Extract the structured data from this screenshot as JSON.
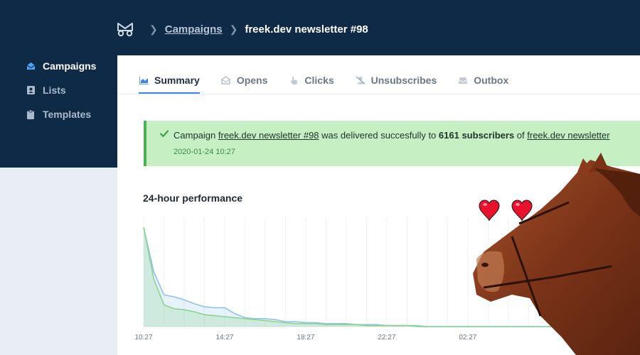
{
  "breadcrumb": {
    "parent": "Campaigns",
    "current": "freek.dev newsletter #98"
  },
  "sidebar": {
    "items": [
      {
        "label": "Campaigns",
        "icon": "envelope-open-icon",
        "active": true
      },
      {
        "label": "Lists",
        "icon": "address-book-icon",
        "active": false
      },
      {
        "label": "Templates",
        "icon": "clipboard-icon",
        "active": false
      }
    ]
  },
  "tabs": [
    {
      "label": "Summary",
      "icon": "chart-area-icon",
      "active": true
    },
    {
      "label": "Opens",
      "icon": "envelope-open-icon",
      "active": false
    },
    {
      "label": "Clicks",
      "icon": "pointer-hand-icon",
      "active": false
    },
    {
      "label": "Unsubscribes",
      "icon": "user-slash-icon",
      "active": false
    },
    {
      "label": "Outbox",
      "icon": "inbox-icon",
      "active": false
    }
  ],
  "alert": {
    "prefix": "Campaign",
    "campaign_link": "freek.dev newsletter #98",
    "middle": "was delivered succesfully to",
    "count": "6161 subscribers",
    "of": "of",
    "list_link": "freek.dev newsletter",
    "date": "2020-01-24 10:27"
  },
  "performance": {
    "title": "24-hour performance"
  },
  "colors": {
    "navy": "#0f2a47",
    "accent": "#3b82f6",
    "success_bg": "#c6efc4",
    "success_border": "#4caf50",
    "opens_line": "#90c2ee",
    "clicks_line": "#8fd48f"
  },
  "chart_data": {
    "type": "area",
    "x_tick_labels": [
      "10:27",
      "14:27",
      "18:27",
      "22:27",
      "02:27"
    ],
    "series": [
      {
        "values": [
          100,
          55,
          32,
          30,
          27,
          23,
          20,
          19,
          19,
          13,
          9,
          8,
          8,
          7,
          5,
          5,
          4,
          4,
          3,
          3,
          3,
          2,
          2,
          2,
          1,
          1,
          1,
          0,
          0,
          0,
          0,
          0,
          0,
          0,
          0,
          0,
          0,
          0,
          0,
          0,
          0,
          0,
          0,
          0,
          0,
          0,
          0,
          0,
          0,
          0
        ]
      },
      {
        "values": [
          100,
          48,
          22,
          18,
          17,
          15,
          12,
          11,
          10,
          9,
          8,
          7,
          6,
          5,
          4,
          3,
          3,
          3,
          2,
          2,
          2,
          2,
          1,
          1,
          1,
          1,
          1,
          1,
          0,
          0,
          0,
          0,
          0,
          0,
          0,
          0,
          0,
          0,
          0,
          0,
          0,
          0,
          0,
          0,
          0,
          0,
          0,
          0,
          0,
          0
        ]
      }
    ],
    "grid": true
  }
}
